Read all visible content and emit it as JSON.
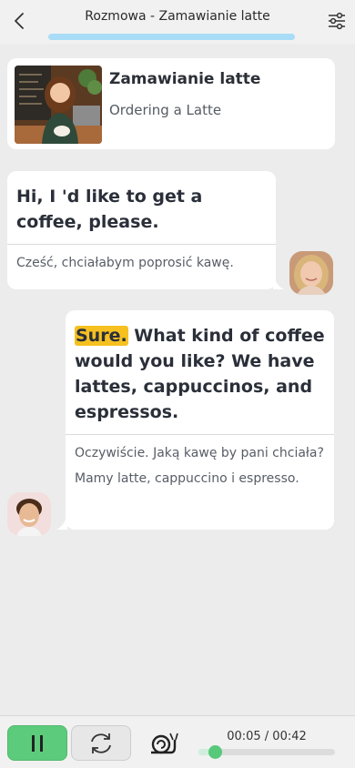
{
  "header": {
    "title": "Rozmowa - Zamawianie latte",
    "progress": 1.0,
    "back_icon": "chevron-left-icon",
    "settings_icon": "sliders-icon"
  },
  "lesson": {
    "title": "Zamawianie latte",
    "subtitle": "Ordering a Latte"
  },
  "messages": [
    {
      "speaker": "woman",
      "text": "Hi, I 'd like to get a coffee, please.",
      "translation": "Cześć, chciałabym poprosić kawę."
    },
    {
      "speaker": "boy",
      "highlight": "Sure.",
      "text_rest": " What kind of coffee would you like? We have lattes, cappuccinos, and espressos.",
      "translation": "Oczywiście. Jaką kawę by pani chciała? Mamy latte, cappuccino i espresso."
    }
  ],
  "player": {
    "time_label": "00:05 / 00:42",
    "position_fraction": 0.12,
    "pause_icon": "pause-icon",
    "repeat_icon": "repeat-icon",
    "slow_icon": "snail-icon",
    "accent": "#5ccc7c"
  }
}
